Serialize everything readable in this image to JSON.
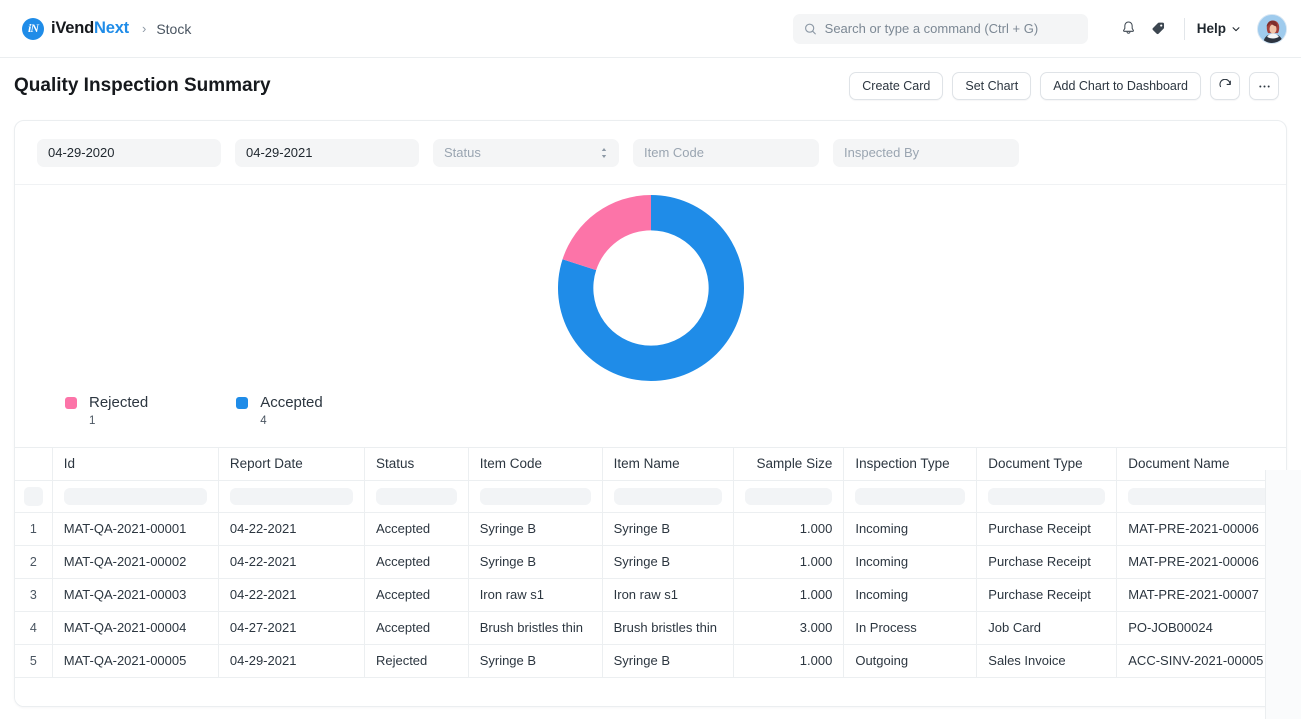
{
  "navbar": {
    "brand_prefix": "iVend",
    "brand_suffix": "Next",
    "breadcrumb_separator": "›",
    "breadcrumb": "Stock",
    "search_placeholder": "Search or type a command (Ctrl + G)",
    "search_value": "",
    "notifications_icon": "bell-icon",
    "tag_icon": "tag-icon",
    "help_label": "Help",
    "avatar_alt": "user-avatar"
  },
  "page": {
    "title": "Quality Inspection Summary",
    "actions": [
      {
        "label": "Create Card",
        "name": "create-card-button"
      },
      {
        "label": "Set Chart",
        "name": "set-chart-button"
      },
      {
        "label": "Add Chart to Dashboard",
        "name": "add-chart-to-dashboard-button"
      }
    ],
    "refresh_icon": "refresh-icon",
    "more_icon": "ellipsis-icon"
  },
  "filters": {
    "from_date": "04-29-2020",
    "to_date": "04-29-2021",
    "status_placeholder": "Status",
    "status_value": "",
    "item_code_placeholder": "Item Code",
    "item_code_value": "",
    "inspected_by_placeholder": "Inspected By",
    "inspected_by_value": ""
  },
  "chart_data": {
    "type": "pie",
    "title": "Quality Inspection Summary",
    "variant": "donut",
    "categories": [
      "Rejected",
      "Accepted"
    ],
    "values": [
      1,
      4
    ],
    "colors": [
      "#fc74a8",
      "#1f8ce8"
    ],
    "total": 5,
    "percentages": [
      20,
      80
    ],
    "legend_position": "bottom-left",
    "start_angle_deg": 0,
    "direction": "counterclockwise",
    "inner_radius_ratio": 0.62,
    "xlabel": "",
    "ylabel": ""
  },
  "table": {
    "columns": [
      "Id",
      "Report Date",
      "Status",
      "Item Code",
      "Item Name",
      "Sample Size",
      "Inspection Type",
      "Document Type",
      "Document Name"
    ],
    "rows": [
      {
        "index": "1",
        "id": "MAT-QA-2021-00001",
        "report_date": "04-22-2021",
        "status": "Accepted",
        "item_code": "Syringe B",
        "item_name": "Syringe B",
        "sample_size": "1.000",
        "inspection_type": "Incoming",
        "document_type": "Purchase Receipt",
        "document_name": "MAT-PRE-2021-00006"
      },
      {
        "index": "2",
        "id": "MAT-QA-2021-00002",
        "report_date": "04-22-2021",
        "status": "Accepted",
        "item_code": "Syringe B",
        "item_name": "Syringe B",
        "sample_size": "1.000",
        "inspection_type": "Incoming",
        "document_type": "Purchase Receipt",
        "document_name": "MAT-PRE-2021-00006"
      },
      {
        "index": "3",
        "id": "MAT-QA-2021-00003",
        "report_date": "04-22-2021",
        "status": "Accepted",
        "item_code": "Iron raw s1",
        "item_name": "Iron raw s1",
        "sample_size": "1.000",
        "inspection_type": "Incoming",
        "document_type": "Purchase Receipt",
        "document_name": "MAT-PRE-2021-00007"
      },
      {
        "index": "4",
        "id": "MAT-QA-2021-00004",
        "report_date": "04-27-2021",
        "status": "Accepted",
        "item_code": "Brush bristles thin",
        "item_name": "Brush bristles thin",
        "sample_size": "3.000",
        "inspection_type": "In Process",
        "document_type": "Job Card",
        "document_name": "PO-JOB00024"
      },
      {
        "index": "5",
        "id": "MAT-QA-2021-00005",
        "report_date": "04-29-2021",
        "status": "Rejected",
        "item_code": "Syringe B",
        "item_name": "Syringe B",
        "sample_size": "1.000",
        "inspection_type": "Outgoing",
        "document_type": "Sales Invoice",
        "document_name": "ACC-SINV-2021-00005"
      }
    ]
  },
  "theme": {
    "accent": "#1f8ce8",
    "rejected": "#fc74a8",
    "accepted": "#1f8ce8",
    "text": "#2c3640",
    "border": "#ebeef0"
  }
}
